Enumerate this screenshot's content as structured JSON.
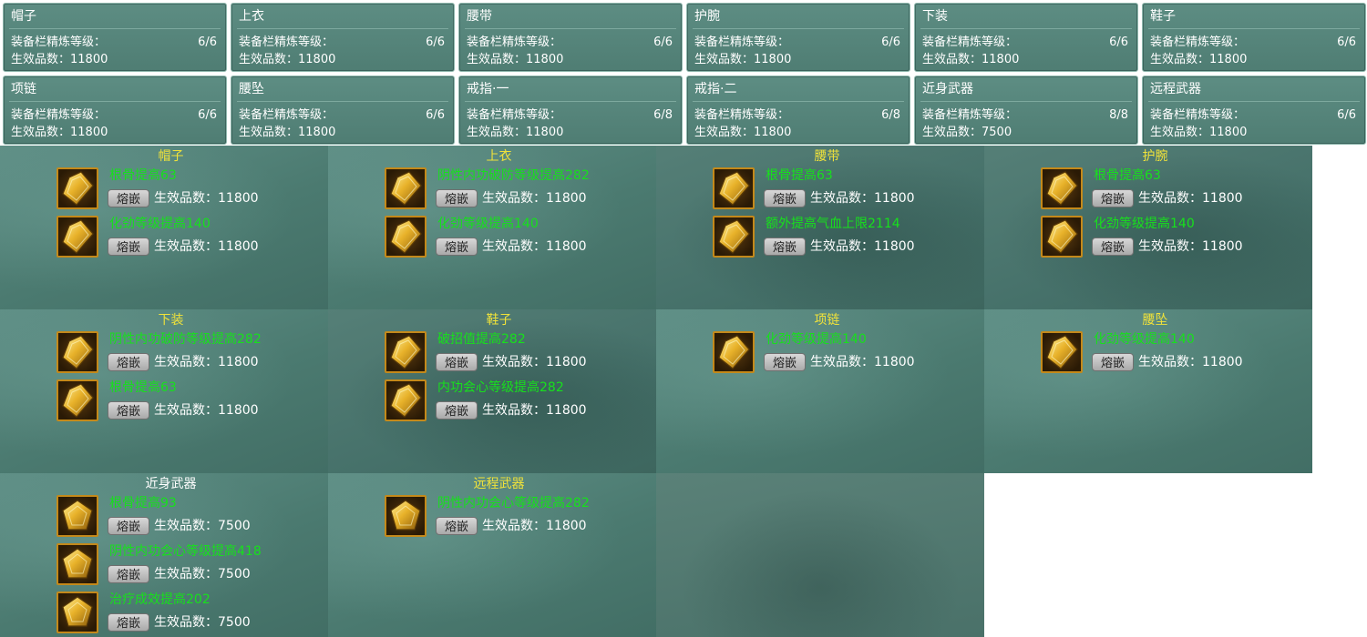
{
  "slot_summary": {
    "refine_label": "装备栏精炼等级：",
    "quality_label": "生效品数：",
    "slots": [
      {
        "name": "帽子",
        "refine": "6/6",
        "quality": "11800"
      },
      {
        "name": "上衣",
        "refine": "6/6",
        "quality": "11800"
      },
      {
        "name": "腰带",
        "refine": "6/6",
        "quality": "11800"
      },
      {
        "name": "护腕",
        "refine": "6/6",
        "quality": "11800"
      },
      {
        "name": "下装",
        "refine": "6/6",
        "quality": "11800"
      },
      {
        "name": "鞋子",
        "refine": "6/6",
        "quality": "11800"
      },
      {
        "name": "项链",
        "refine": "6/6",
        "quality": "11800"
      },
      {
        "name": "腰坠",
        "refine": "6/6",
        "quality": "11800"
      },
      {
        "name": "戒指·一",
        "refine": "6/8",
        "quality": "11800"
      },
      {
        "name": "戒指·二",
        "refine": "6/8",
        "quality": "11800"
      },
      {
        "name": "近身武器",
        "refine": "8/8",
        "quality": "7500"
      },
      {
        "name": "远程武器",
        "refine": "6/6",
        "quality": "11800"
      }
    ]
  },
  "gem_panels": {
    "inlay_label": "熔嵌",
    "quality_label": "生效品数：",
    "panels": [
      {
        "title": "帽子",
        "gems": [
          {
            "effect": "根骨提高63",
            "quality": "11800"
          },
          {
            "effect": "化劲等级提高140",
            "quality": "11800"
          }
        ]
      },
      {
        "title": "上衣",
        "gems": [
          {
            "effect": "阴性内功破防等级提高282",
            "quality": "11800"
          },
          {
            "effect": "化劲等级提高140",
            "quality": "11800"
          }
        ]
      },
      {
        "title": "腰带",
        "gems": [
          {
            "effect": "根骨提高63",
            "quality": "11800"
          },
          {
            "effect": "额外提高气血上限2114",
            "quality": "11800"
          }
        ]
      },
      {
        "title": "护腕",
        "gems": [
          {
            "effect": "根骨提高63",
            "quality": "11800"
          },
          {
            "effect": "化劲等级提高140",
            "quality": "11800"
          }
        ]
      },
      {
        "title": "下装",
        "gems": [
          {
            "effect": "阴性内功破防等级提高282",
            "quality": "11800"
          },
          {
            "effect": "根骨提高63",
            "quality": "11800"
          }
        ]
      },
      {
        "title": "鞋子",
        "gems": [
          {
            "effect": "破招值提高282",
            "quality": "11800"
          },
          {
            "effect": "内功会心等级提高282",
            "quality": "11800"
          }
        ]
      },
      {
        "title": "项链",
        "gems": [
          {
            "effect": "化劲等级提高140",
            "quality": "11800"
          }
        ]
      },
      {
        "title": "腰坠",
        "gems": [
          {
            "effect": "化劲等级提高140",
            "quality": "11800"
          }
        ]
      },
      {
        "title": "近身武器",
        "title_color": "#ffffff",
        "gems": [
          {
            "effect": "根骨提高93",
            "quality": "7500"
          },
          {
            "effect": "阴性内功会心等级提高418",
            "quality": "7500"
          },
          {
            "effect": "治疗成效提高202",
            "quality": "7500"
          }
        ]
      },
      {
        "title": "远程武器",
        "gems": [
          {
            "effect": "阴性内功会心等级提高282",
            "quality": "11800"
          }
        ]
      }
    ]
  },
  "colors": {
    "effect_text": "#17e01c",
    "panel_title": "#f0e23a",
    "gem_border": "#c4891a"
  },
  "icons": {
    "gem": "golden-gem-icon",
    "weapon_gem": "golden-pentagon-gem-icon"
  }
}
